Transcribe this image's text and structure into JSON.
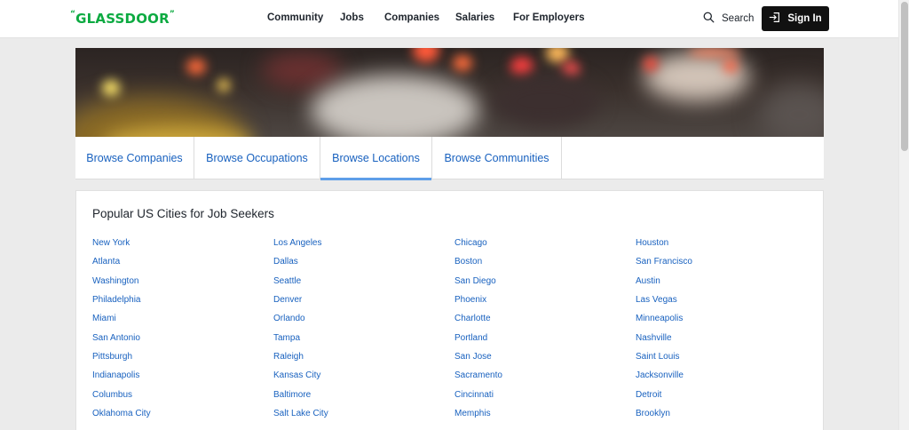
{
  "header": {
    "logo_text": "GLASSDOOR",
    "nav": [
      "Community",
      "Jobs",
      "Companies",
      "Salaries",
      "For Employers"
    ],
    "search_label": "Search",
    "signin_label": "Sign In"
  },
  "tabs": [
    "Browse Companies",
    "Browse Occupations",
    "Browse Locations",
    "Browse Communities"
  ],
  "active_tab": "Browse Locations",
  "section": {
    "title": "Popular US Cities for Job Seekers",
    "cities": [
      "New York",
      "Los Angeles",
      "Chicago",
      "Houston",
      "Atlanta",
      "Dallas",
      "Boston",
      "San Francisco",
      "Washington",
      "Seattle",
      "San Diego",
      "Austin",
      "Philadelphia",
      "Denver",
      "Phoenix",
      "Las Vegas",
      "Miami",
      "Orlando",
      "Charlotte",
      "Minneapolis",
      "San Antonio",
      "Tampa",
      "Portland",
      "Nashville",
      "Pittsburgh",
      "Raleigh",
      "San Jose",
      "Saint Louis",
      "Indianapolis",
      "Kansas City",
      "Sacramento",
      "Jacksonville",
      "Columbus",
      "Baltimore",
      "Cincinnati",
      "Detroit",
      "Oklahoma City",
      "Salt Lake City",
      "Memphis",
      "Brooklyn"
    ]
  },
  "colors": {
    "brand": "#0caa41",
    "link": "#1861bf",
    "active_tab_underline": "#5e9ee8",
    "signin_bg": "#111111"
  },
  "icons": [
    "search-icon",
    "sign-in-icon"
  ]
}
